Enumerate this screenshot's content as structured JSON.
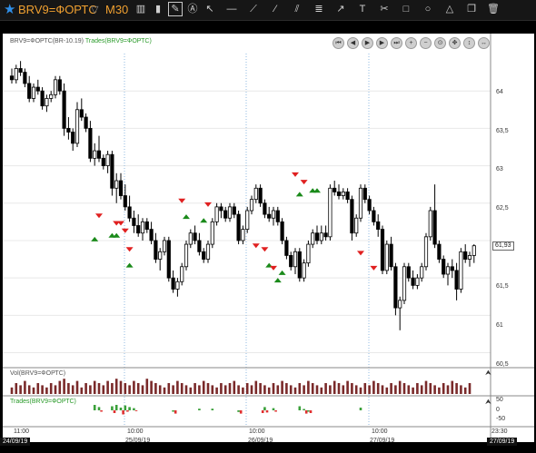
{
  "toolbar": {
    "symbol": "BRV9=ФОРТС",
    "timeframe": "M30",
    "tools": [
      "bar-chart-icon",
      "candle-icon",
      "pencil-icon",
      "text-select-icon",
      "cursor-icon",
      "horizontal-line-icon",
      "ray-icon",
      "trend-line-icon",
      "channel-icon",
      "fibonacci-icon",
      "arrow-icon",
      "text-tool-icon",
      "cut-icon",
      "rectangle-icon",
      "ellipse-icon",
      "triangle-icon",
      "copy-icon",
      "trash-icon"
    ]
  },
  "main_pane": {
    "title": "BRV9=ФОРТС(BR-10.19)",
    "indicator": "Trades(BRV9=ФОРТС)",
    "y_ticks": [
      "64",
      "63,5",
      "63",
      "62,5",
      "62",
      "61,5",
      "61",
      "60,5"
    ],
    "last_price": "61,93"
  },
  "volume_pane": {
    "title": "Vol(BRV9=ФОРТС)"
  },
  "trades_pane": {
    "title": "Trades(BRV9=ФОРТС)",
    "y_ticks": [
      "50",
      "0",
      "-50"
    ]
  },
  "x_axis": {
    "times": [
      "11:00",
      "10:00",
      "10:00",
      "10:00",
      "23:30"
    ],
    "dates": [
      "24/09/19",
      "25/09/19",
      "26/09/19",
      "27/09/19",
      "27/09/19"
    ]
  },
  "nav_buttons": [
    "first-icon",
    "prev-icon",
    "play-icon",
    "next-icon",
    "last-icon",
    "zoom-in-icon",
    "zoom-out-icon",
    "zoom-fit-icon",
    "move-icon",
    "move-vertical-icon",
    "move-horizontal-icon"
  ],
  "colors": {
    "up": "#ffffff",
    "down": "#000000",
    "buy": "#1a8a1a",
    "sell": "#e02020",
    "volume": "#7a2a2a",
    "accent": "#f0a030"
  },
  "chart_data": {
    "type": "candlestick",
    "ylim": [
      60.3,
      64.5
    ],
    "candles": [
      [
        64.2,
        64.3,
        64.1,
        64.15
      ],
      [
        64.15,
        64.35,
        64.1,
        64.3
      ],
      [
        64.3,
        64.4,
        64.2,
        64.25
      ],
      [
        64.25,
        64.3,
        64.05,
        64.1
      ],
      [
        64.1,
        64.2,
        63.85,
        63.9
      ],
      [
        63.9,
        64.1,
        63.85,
        64.05
      ],
      [
        64.05,
        64.15,
        63.95,
        64.0
      ],
      [
        64.0,
        64.05,
        63.75,
        63.8
      ],
      [
        63.8,
        63.95,
        63.72,
        63.9
      ],
      [
        63.9,
        64.0,
        63.85,
        63.95
      ],
      [
        63.95,
        64.2,
        63.9,
        64.15
      ],
      [
        64.15,
        64.2,
        63.95,
        64.0
      ],
      [
        64.0,
        64.1,
        63.4,
        63.5
      ],
      [
        63.5,
        63.65,
        63.35,
        63.45
      ],
      [
        63.45,
        63.5,
        63.2,
        63.3
      ],
      [
        63.3,
        63.85,
        63.25,
        63.75
      ],
      [
        63.75,
        63.9,
        63.6,
        63.65
      ],
      [
        63.65,
        63.7,
        63.45,
        63.5
      ],
      [
        63.5,
        63.6,
        63.05,
        63.1
      ],
      [
        63.1,
        63.3,
        63.0,
        63.2
      ],
      [
        63.2,
        63.4,
        63.05,
        63.1
      ],
      [
        63.1,
        63.15,
        62.95,
        63.0
      ],
      [
        63.0,
        63.2,
        62.9,
        63.15
      ],
      [
        63.15,
        63.2,
        62.6,
        62.7
      ],
      [
        62.7,
        62.9,
        62.5,
        62.8
      ],
      [
        62.8,
        62.9,
        62.55,
        62.6
      ],
      [
        62.6,
        62.75,
        62.4,
        62.45
      ],
      [
        62.45,
        62.6,
        62.25,
        62.3
      ],
      [
        62.3,
        62.4,
        62.1,
        62.2
      ],
      [
        62.2,
        62.35,
        62.05,
        62.1
      ],
      [
        62.1,
        62.3,
        62.0,
        62.25
      ],
      [
        62.25,
        62.3,
        62.1,
        62.15
      ],
      [
        62.15,
        62.25,
        61.95,
        62.0
      ],
      [
        62.0,
        62.1,
        61.7,
        61.75
      ],
      [
        61.75,
        61.9,
        61.6,
        61.85
      ],
      [
        61.85,
        62.05,
        61.8,
        62.0
      ],
      [
        62.0,
        62.05,
        61.45,
        61.5
      ],
      [
        61.5,
        61.6,
        61.3,
        61.35
      ],
      [
        61.35,
        61.5,
        61.25,
        61.45
      ],
      [
        61.45,
        61.7,
        61.4,
        61.65
      ],
      [
        61.65,
        62.0,
        61.6,
        61.95
      ],
      [
        61.95,
        62.15,
        61.9,
        62.1
      ],
      [
        62.1,
        62.2,
        61.95,
        62.0
      ],
      [
        62.0,
        62.1,
        61.8,
        61.85
      ],
      [
        61.85,
        61.9,
        61.7,
        61.75
      ],
      [
        61.75,
        62.0,
        61.7,
        61.95
      ],
      [
        61.95,
        62.3,
        61.9,
        62.25
      ],
      [
        62.25,
        62.5,
        62.2,
        62.45
      ],
      [
        62.45,
        62.5,
        62.3,
        62.4
      ],
      [
        62.4,
        62.45,
        62.25,
        62.3
      ],
      [
        62.3,
        62.5,
        62.25,
        62.45
      ],
      [
        62.45,
        62.5,
        62.3,
        62.35
      ],
      [
        62.35,
        62.4,
        61.95,
        62.0
      ],
      [
        62.0,
        62.2,
        61.95,
        62.15
      ],
      [
        62.15,
        62.45,
        62.1,
        62.4
      ],
      [
        62.4,
        62.6,
        62.35,
        62.55
      ],
      [
        62.55,
        62.75,
        62.5,
        62.7
      ],
      [
        62.7,
        62.75,
        62.45,
        62.5
      ],
      [
        62.5,
        62.55,
        62.3,
        62.35
      ],
      [
        62.35,
        62.45,
        62.25,
        62.3
      ],
      [
        62.3,
        62.45,
        62.2,
        62.4
      ],
      [
        62.4,
        62.45,
        62.2,
        62.25
      ],
      [
        62.25,
        62.3,
        61.95,
        62.0
      ],
      [
        62.0,
        62.05,
        61.75,
        61.8
      ],
      [
        61.8,
        61.85,
        61.6,
        61.65
      ],
      [
        61.65,
        61.9,
        61.55,
        61.85
      ],
      [
        61.85,
        61.9,
        61.45,
        61.5
      ],
      [
        61.5,
        61.75,
        61.45,
        61.7
      ],
      [
        61.7,
        62.0,
        61.65,
        61.95
      ],
      [
        61.95,
        62.15,
        61.9,
        62.1
      ],
      [
        62.1,
        62.2,
        61.95,
        62.0
      ],
      [
        62.0,
        62.2,
        61.95,
        62.1
      ],
      [
        62.1,
        62.2,
        62.0,
        62.05
      ],
      [
        62.05,
        62.75,
        62.0,
        62.7
      ],
      [
        62.7,
        62.8,
        62.6,
        62.65
      ],
      [
        62.65,
        62.75,
        62.55,
        62.6
      ],
      [
        62.6,
        62.7,
        62.55,
        62.65
      ],
      [
        62.65,
        62.7,
        62.5,
        62.55
      ],
      [
        62.55,
        62.6,
        62.0,
        62.1
      ],
      [
        62.1,
        62.35,
        62.05,
        62.3
      ],
      [
        62.3,
        62.75,
        62.25,
        62.7
      ],
      [
        62.7,
        62.75,
        62.5,
        62.55
      ],
      [
        62.55,
        62.6,
        62.35,
        62.4
      ],
      [
        62.4,
        62.45,
        62.2,
        62.25
      ],
      [
        62.25,
        62.35,
        62.05,
        62.15
      ],
      [
        62.15,
        62.2,
        61.55,
        61.6
      ],
      [
        61.6,
        62.0,
        61.55,
        61.95
      ],
      [
        61.95,
        62.05,
        61.6,
        61.65
      ],
      [
        61.65,
        61.7,
        61.0,
        61.1
      ],
      [
        61.1,
        61.25,
        60.8,
        61.2
      ],
      [
        61.2,
        61.7,
        61.15,
        61.65
      ],
      [
        61.65,
        61.7,
        61.45,
        61.5
      ],
      [
        61.5,
        61.6,
        61.35,
        61.4
      ],
      [
        61.4,
        61.55,
        61.35,
        61.5
      ],
      [
        61.5,
        61.7,
        61.45,
        61.65
      ],
      [
        61.65,
        62.1,
        61.6,
        62.05
      ],
      [
        62.05,
        62.45,
        62.0,
        62.4
      ],
      [
        62.4,
        62.75,
        61.9,
        61.95
      ],
      [
        61.95,
        62.0,
        61.7,
        61.75
      ],
      [
        61.75,
        61.8,
        61.5,
        61.55
      ],
      [
        61.55,
        61.7,
        61.4,
        61.65
      ],
      [
        61.65,
        61.75,
        61.5,
        61.6
      ],
      [
        61.6,
        61.7,
        61.2,
        61.35
      ],
      [
        61.35,
        61.9,
        61.3,
        61.85
      ],
      [
        61.85,
        61.95,
        61.7,
        61.75
      ],
      [
        61.75,
        61.85,
        61.65,
        61.8
      ],
      [
        61.8,
        61.95,
        61.7,
        61.93
      ]
    ],
    "buy_markers": [
      [
        19,
        62.05
      ],
      [
        23,
        62.1
      ],
      [
        24,
        62.1
      ],
      [
        27,
        61.7
      ],
      [
        40,
        62.35
      ],
      [
        44,
        62.3
      ],
      [
        59,
        61.7
      ],
      [
        61,
        61.5
      ],
      [
        62,
        61.6
      ],
      [
        66,
        62.65
      ],
      [
        69,
        62.7
      ],
      [
        70,
        62.7
      ]
    ],
    "sell_markers": [
      [
        20,
        62.3
      ],
      [
        24,
        62.2
      ],
      [
        25,
        62.2
      ],
      [
        26,
        62.1
      ],
      [
        27,
        61.85
      ],
      [
        39,
        62.5
      ],
      [
        45,
        62.45
      ],
      [
        56,
        61.9
      ],
      [
        58,
        61.85
      ],
      [
        60,
        61.6
      ],
      [
        65,
        62.85
      ],
      [
        67,
        62.75
      ],
      [
        80,
        61.8
      ],
      [
        83,
        61.6
      ]
    ],
    "volume": [
      3,
      5,
      4,
      6,
      4,
      3,
      5,
      4,
      3,
      5,
      4,
      6,
      7,
      5,
      4,
      6,
      3,
      5,
      4,
      6,
      5,
      4,
      6,
      5,
      7,
      6,
      5,
      4,
      6,
      5,
      4,
      7,
      6,
      5,
      4,
      3,
      5,
      4,
      6,
      5,
      4,
      3,
      5,
      4,
      6,
      5,
      4,
      3,
      5,
      4,
      5,
      6,
      4,
      3,
      5,
      4,
      6,
      5,
      4,
      3,
      5,
      4,
      6,
      5,
      4,
      3,
      5,
      4,
      6,
      5,
      4,
      3,
      5,
      4,
      6,
      5,
      4,
      6,
      5,
      4,
      3,
      5,
      4,
      6,
      5,
      4,
      3,
      5,
      4,
      6,
      5,
      4,
      3,
      5,
      4,
      6,
      5,
      4,
      3,
      5,
      4,
      6,
      5,
      4,
      3,
      5
    ],
    "trades": [
      [
        19,
        20,
        5
      ],
      [
        20,
        12,
        -5
      ],
      [
        23,
        15,
        -10
      ],
      [
        24,
        20,
        0
      ],
      [
        25,
        10,
        -15
      ],
      [
        26,
        18,
        -5
      ],
      [
        27,
        12,
        0
      ],
      [
        28,
        8,
        -3
      ],
      [
        37,
        -5,
        -12
      ],
      [
        43,
        6,
        0
      ],
      [
        46,
        6,
        0
      ],
      [
        52,
        -6,
        -12
      ],
      [
        57,
        0,
        -10
      ],
      [
        58,
        12,
        -8
      ],
      [
        60,
        8,
        -5
      ],
      [
        66,
        15,
        0
      ],
      [
        67,
        5,
        -12
      ],
      [
        68,
        -5,
        -10
      ],
      [
        80,
        10,
        0
      ]
    ]
  }
}
